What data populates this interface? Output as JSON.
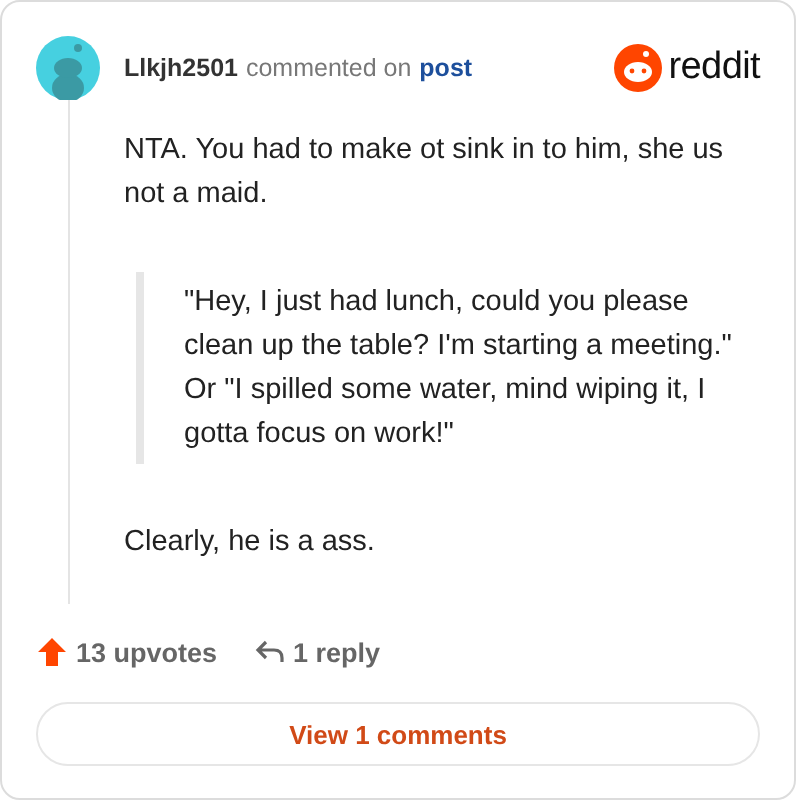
{
  "comment": {
    "author": "Llkjh2501",
    "action": "commented on",
    "target": "post",
    "brand": "reddit",
    "paragraphs": [
      {
        "kind": "text",
        "text": "NTA. You had to make ot sink in to him, she us not a maid."
      },
      {
        "kind": "quote",
        "text": "\"Hey, I just had lunch, could you please clean up the table? I'm starting a meeting.\" Or \"I spilled some water, mind wiping it, I gotta focus on work!\""
      },
      {
        "kind": "text",
        "text": "Clearly, he is a ass."
      }
    ],
    "upvotes": "13 upvotes",
    "replies": "1 reply"
  },
  "view_button": "View 1 comments"
}
